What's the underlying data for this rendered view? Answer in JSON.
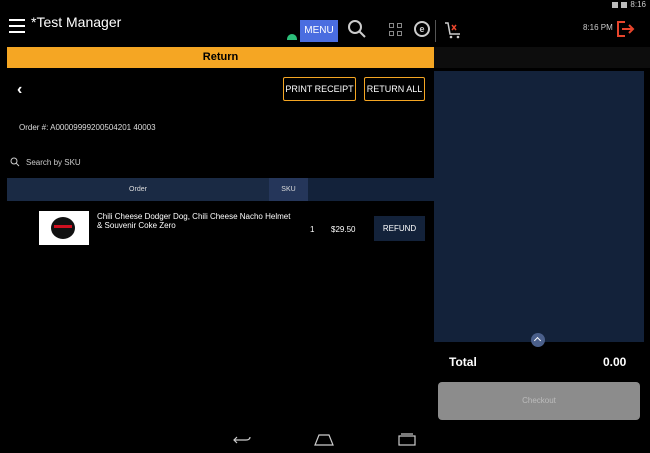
{
  "status_bar": {
    "time": "8:16"
  },
  "header": {
    "title": "*Test Manager",
    "menu_label": "MENU",
    "clock": "8:16 PM",
    "e_icon_letter": "e"
  },
  "banner": {
    "label": "Return"
  },
  "actions": {
    "print_receipt": "PRINT RECEIPT",
    "return_all": "RETURN ALL"
  },
  "order": {
    "number_text": "Order #: A00009999200504201 40003"
  },
  "search": {
    "placeholder": "Search by SKU"
  },
  "tabs": [
    {
      "label": "Order"
    },
    {
      "label": "SKU"
    }
  ],
  "items": [
    {
      "name": "Chili Cheese Dodger Dog, Chili Cheese Nacho Helmet & Souvenir Coke Zero",
      "quantity": "1",
      "price": "$29.50",
      "action": "REFUND"
    }
  ],
  "cart": {
    "total_label": "Total",
    "total_value": "0.00",
    "checkout_label": "Checkout"
  },
  "colors": {
    "accent_orange": "#f5a623",
    "menu_blue": "#4a6de0",
    "panel_navy": "#13223a",
    "status_green": "#2dbf7a",
    "logout_red": "#e8452c"
  }
}
